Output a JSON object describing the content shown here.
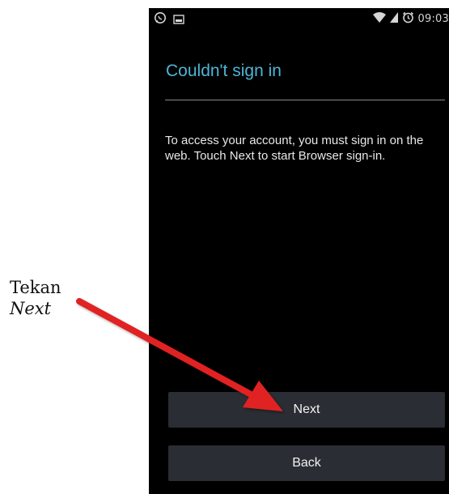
{
  "status_bar": {
    "left_icons": [
      "whatsapp-icon",
      "image-icon"
    ],
    "right_icons": [
      "wifi-icon",
      "signal-icon",
      "alarm-icon"
    ],
    "time": "09:03"
  },
  "dialog": {
    "title": "Couldn't sign in",
    "message": "To access your account, you must sign in on the web. Touch Next to start Browser sign-in.",
    "next_label": "Next",
    "back_label": "Back"
  },
  "annotation": {
    "line1": "Tekan",
    "line2": "Next",
    "arrow_color": "#e02020"
  },
  "colors": {
    "title": "#4fb4d8",
    "screen_bg": "#000000",
    "button_bg": "#2a2d33"
  }
}
